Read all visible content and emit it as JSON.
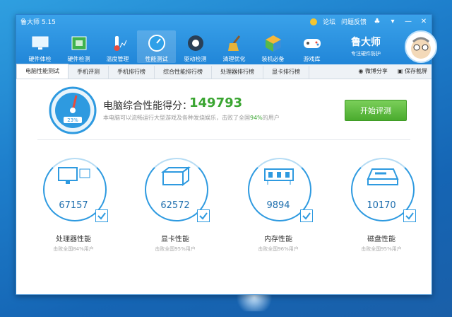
{
  "app": {
    "title": "鲁大师 5.15",
    "forum": "论坛",
    "feedback": "问题反馈",
    "brand_name": "鲁大师",
    "brand_slogan": "专注硬件防护"
  },
  "nav": [
    {
      "label": "硬件体检",
      "icon": "monitor-icon"
    },
    {
      "label": "硬件检测",
      "icon": "chip-icon"
    },
    {
      "label": "温度管理",
      "icon": "thermometer-icon"
    },
    {
      "label": "性能测试",
      "icon": "speedometer-icon",
      "active": true
    },
    {
      "label": "驱动检测",
      "icon": "gear-icon"
    },
    {
      "label": "清理优化",
      "icon": "broom-icon"
    },
    {
      "label": "装机必备",
      "icon": "cube-icon"
    },
    {
      "label": "游戏库",
      "icon": "gamepad-icon"
    }
  ],
  "tabs": [
    {
      "label": "电脑性能测试",
      "active": true
    },
    {
      "label": "手机评测"
    },
    {
      "label": "手机排行榜"
    },
    {
      "label": "综合性能排行榜"
    },
    {
      "label": "处理器排行榜"
    },
    {
      "label": "显卡排行榜"
    }
  ],
  "tab_actions": {
    "share": "微博分享",
    "screenshot": "保存截屏"
  },
  "score": {
    "label": "电脑综合性能得分：",
    "value": "149793",
    "desc_prefix": "本电脑可以流畅运行大型游戏及各种发烧娱乐，击败了全国",
    "desc_pct": "94%",
    "desc_suffix": "的用户",
    "gauge_reading": "23%"
  },
  "start_button": "开始评测",
  "cards": [
    {
      "title": "处理器性能",
      "value": "67157",
      "sub": "击败全国84%用户",
      "icon": "cpu-icon"
    },
    {
      "title": "显卡性能",
      "value": "62572",
      "sub": "击败全国95%用户",
      "icon": "gpu-icon"
    },
    {
      "title": "内存性能",
      "value": "9894",
      "sub": "击败全国96%用户",
      "icon": "memory-icon"
    },
    {
      "title": "磁盘性能",
      "value": "10170",
      "sub": "击败全国95%用户",
      "icon": "disk-icon"
    }
  ],
  "colors": {
    "accent": "#2186d8",
    "green": "#3aa531"
  }
}
